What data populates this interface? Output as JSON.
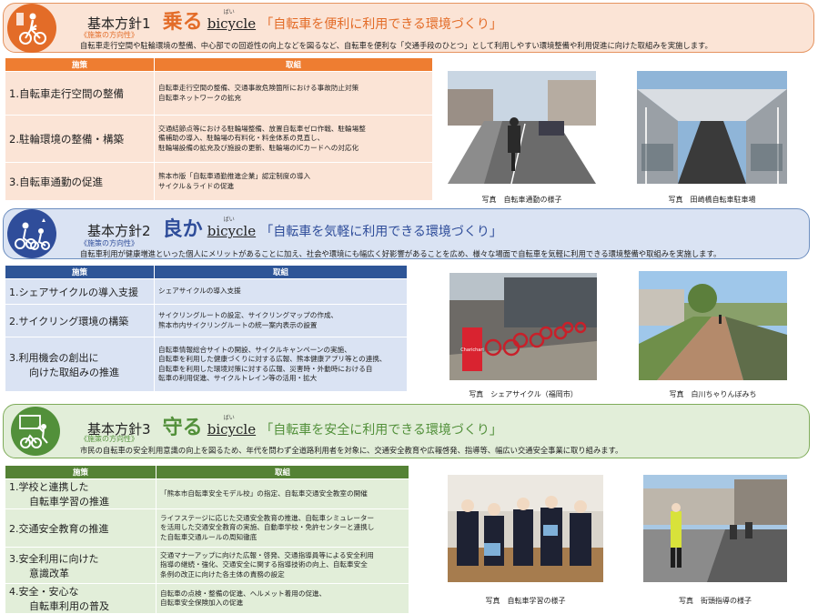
{
  "sections": [
    {
      "label": "基本方針1",
      "keyword": "乗る",
      "bicycle": "bicycle",
      "ruby": "ばい",
      "slogan": "「自転車を便利に利用できる環境づくり」",
      "direction_label": "《施策の方向性》",
      "description": "自転車走行空間や駐輪環境の整備、中心部での回遊性の向上などを図るなど、自転車を便利な「交通手段のひとつ」として利用しやすい環境整備や利用促進に向けた取組みを実施します。",
      "table_header": {
        "policy": "施策",
        "action": "取組"
      },
      "rows": [
        {
          "policy": "1.自転車走行空間の整備",
          "action": "自転車走行空間の整備、交通事故危険箇所における事故防止対策\n自転車ネットワークの拡充"
        },
        {
          "policy": "2.駐輪環境の整備・構築",
          "action": "交通結節点等における駐輪場整備、放置自転車ゼロ作戦、駐輪場整\n備補助の導入、駐輪場の有料化・料金体系の見直し、\n駐輪場設備の拡充及び施設の更新、駐輪場のICカードへの対応化"
        },
        {
          "policy": "3.自転車通勤の促進",
          "action": "熊本市版「自転車通勤推進企業」認定制度の導入\nサイクル＆ライドの促進"
        }
      ],
      "photos": [
        {
          "caption": "写真　自転車通勤の様子"
        },
        {
          "caption": "写真　田崎橋自転車駐車場"
        }
      ]
    },
    {
      "label": "基本方針2",
      "keyword": "良か",
      "bicycle": "bicycle",
      "ruby": "ばい",
      "slogan": "「自転車を気軽に利用できる環境づくり」",
      "direction_label": "《施策の方向性》",
      "description": "自転車利用が健康増進といった個人にメリットがあることに加え、社会や環境にも幅広く好影響があることを広め、様々な場面で自転車を気軽に利用できる環境整備や取組みを実施します。",
      "table_header": {
        "policy": "施策",
        "action": "取組"
      },
      "rows": [
        {
          "policy": "1.シェアサイクルの導入支援",
          "action": "シェアサイクルの導入支援"
        },
        {
          "policy": "2.サイクリング環境の構築",
          "action": "サイクリングルートの設定、サイクリングマップの作成、\n熊本市内サイクリングルートの統一案内表示の設置"
        },
        {
          "policy": "3.利用機会の創出に\n　　向けた取組みの推進",
          "action": "自転車情報総合サイトの開設、サイクルキャンペーンの実施、\n自転車を利用した健康づくりに対する広報、熊本健康アプリ等との連携、\n自転車を利用した環境対策に対する広報、災害時・外動時における自\n転車の利用促進、サイクルトレイン等の活用・拡大"
        }
      ],
      "photos": [
        {
          "caption": "写真　シェアサイクル（福岡市）",
          "sign": "Charichari"
        },
        {
          "caption": "写真　白川ちゃりんぼみち"
        }
      ]
    },
    {
      "label": "基本方針3",
      "keyword": "守る",
      "bicycle": "bicycle",
      "ruby": "ばい",
      "slogan": "「自転車を安全に利用できる環境づくり」",
      "direction_label": "《施策の方向性》",
      "description": "市民の自転車の安全利用意識の向上を図るため、年代を問わず全道路利用者を対象に、交通安全教育や広報啓発、指導等、幅広い交通安全事業に取り組みます。",
      "table_header": {
        "policy": "施策",
        "action": "取組"
      },
      "rows": [
        {
          "policy": "1.学校と連携した\n　　自転車学習の推進",
          "action": "「熊本市自転車安全モデル校」の指定、自転車交通安全教室の開催"
        },
        {
          "policy": "2.交通安全教育の推進",
          "action": "ライフステージに応じた交通安全教育の推進、自転車シミュレーター\nを活用した交通安全教育の実施、自動車学校・免許センターと連携し\nた自転車交通ルールの周知徹底"
        },
        {
          "policy": "3.安全利用に向けた\n　　意識改革",
          "action": "交通マナーアップに向けた広報・啓発、交通指導員等による安全利用\n指導の継続・強化、交通安全に関する指導技術の向上、自転車安全\n条例の改正に向けた各主体の責務の設定"
        },
        {
          "policy": "4.安全・安心な\n　　自転車利用の普及",
          "action": "自転車の点検・整備の促進、ヘルメット着用の促進、\n自転車安全保険加入の促進"
        }
      ],
      "photos": [
        {
          "caption": "写真　自転車学習の様子"
        },
        {
          "caption": "写真　街頭指導の様子"
        }
      ]
    }
  ],
  "colors": {
    "s1_banner": "#fbe4d6",
    "s1_border": "#e5935f",
    "s1_circle": "#e36c28",
    "s1_head": "#ee7d31",
    "s1_row": "#fbe4d6",
    "s1_key": "#e36c28",
    "s2_banner": "#dae3f3",
    "s2_border": "#6c8ebf",
    "s2_circle": "#2f4d9a",
    "s2_head": "#2e5597",
    "s2_row": "#dae3f3",
    "s2_key": "#2f4d9a",
    "s3_banner": "#e2eed9",
    "s3_border": "#7fac5a",
    "s3_circle": "#52903a",
    "s3_head": "#548235",
    "s3_row": "#e2eed9",
    "s3_key": "#52903a"
  },
  "icons": [
    "bicycle-rider-icon",
    "family-cyclists-icon",
    "road-safety-teaching-icon"
  ]
}
